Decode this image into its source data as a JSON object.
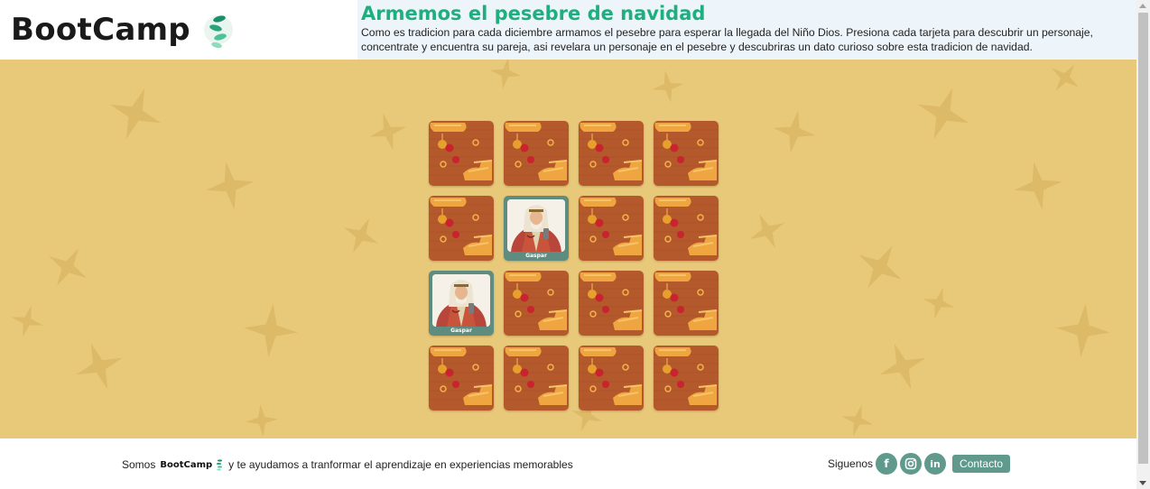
{
  "header": {
    "brand": "BootCamp",
    "title": "Armemos el pesebre de navidad",
    "description": "Como es tradicion para cada diciembre armamos el pesebre para esperar la llegada del Niño Dios. Presiona cada tarjeta para descubrir un personaje, concentrate y encuentra su pareja, asi revelara un personaje en el pesebre y descubriras un dato curioso sobre esta tradicion de navidad."
  },
  "game": {
    "revealed_label": "Gaspar",
    "cards": [
      {
        "state": "hidden"
      },
      {
        "state": "hidden"
      },
      {
        "state": "hidden"
      },
      {
        "state": "hidden"
      },
      {
        "state": "hidden"
      },
      {
        "state": "revealed",
        "name": "Gaspar"
      },
      {
        "state": "hidden"
      },
      {
        "state": "hidden"
      },
      {
        "state": "revealed",
        "name": "Gaspar"
      },
      {
        "state": "hidden"
      },
      {
        "state": "hidden"
      },
      {
        "state": "hidden"
      },
      {
        "state": "hidden"
      },
      {
        "state": "hidden"
      },
      {
        "state": "hidden"
      },
      {
        "state": "hidden"
      }
    ]
  },
  "footer": {
    "somos": "Somos",
    "brand": "BootCamp",
    "tagline": "y te ayudamos a tranformar el aprendizaje en experiencias memorables",
    "siguenos": "Siguenos",
    "social_icons": [
      "facebook-icon",
      "instagram-icon",
      "linkedin-icon"
    ],
    "contact_label": "Contacto"
  },
  "colors": {
    "accent": "#1fae7e",
    "board_background": "#e8c97a",
    "card_back": "#b4592c",
    "teal": "#5f9a8c"
  }
}
